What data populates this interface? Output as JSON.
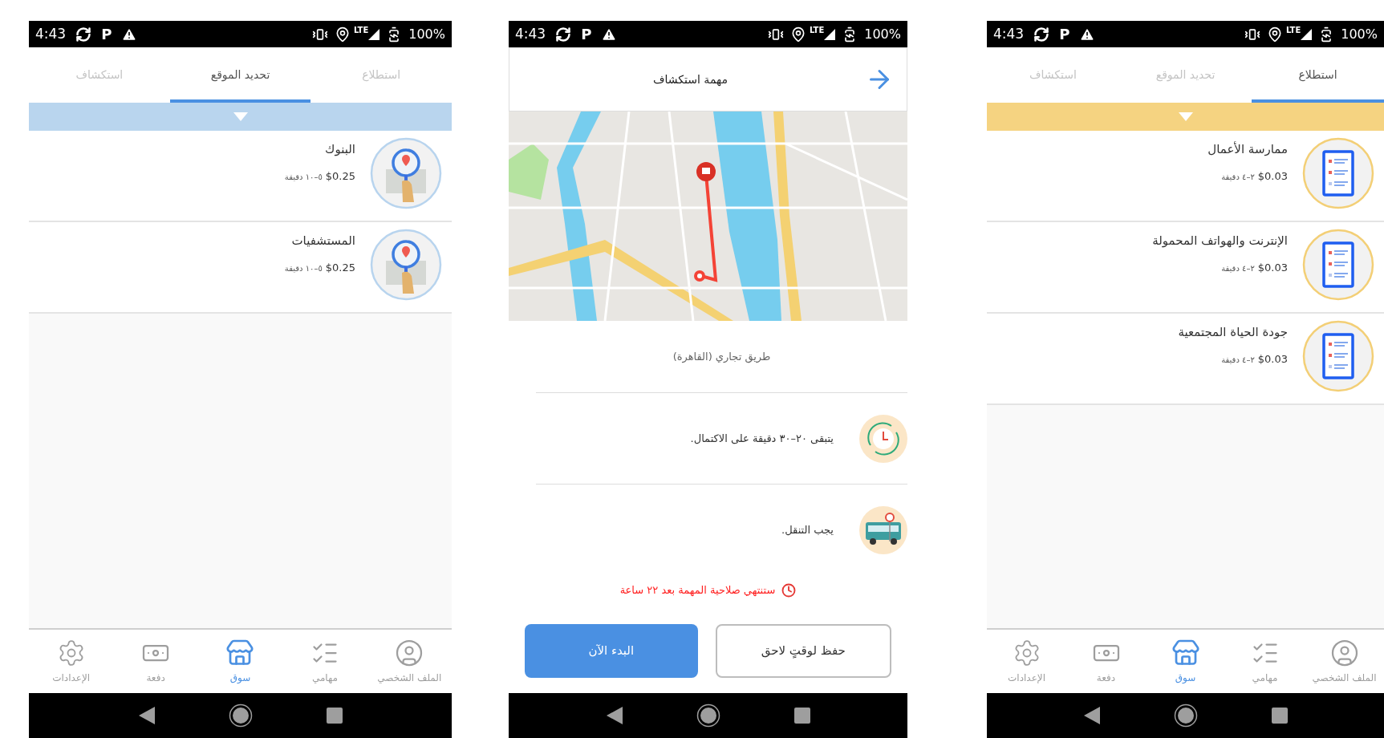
{
  "screens": [
    {
      "kind": "market_list",
      "status_bar": {
        "time": "4:43",
        "letter_icon": "P",
        "network": "LTE",
        "battery": "100%"
      },
      "tabs": [
        {
          "label": "استطلاع",
          "selected": true
        },
        {
          "label": "تحديد الموقع",
          "selected": false
        },
        {
          "label": "استكشاف",
          "selected": false
        }
      ],
      "band": {
        "color": "#f5d381"
      },
      "items": [
        {
          "kind": "survey",
          "title": "ممارسة الأعمال",
          "price": "$0.03",
          "duration": "٢–٤ دقيقة"
        },
        {
          "kind": "survey",
          "title": "الإنترنت والهواتف المحمولة",
          "price": "$0.03",
          "duration": "٢–٤ دقيقة"
        },
        {
          "kind": "survey",
          "title": "جودة الحياة المجتمعية",
          "price": "$0.03",
          "duration": "٢–٤ دقيقة"
        }
      ],
      "bottom_nav": [
        {
          "kind": "profile",
          "label": "الملف الشخصي",
          "selected": false
        },
        {
          "kind": "tasks",
          "label": "مهامي",
          "selected": false
        },
        {
          "kind": "market",
          "label": "سوق",
          "selected": true
        },
        {
          "kind": "payment",
          "label": "دفعة",
          "selected": false
        },
        {
          "kind": "settings",
          "label": "الإعدادات",
          "selected": false
        }
      ]
    },
    {
      "kind": "task_detail",
      "status_bar": {
        "time": "4:43",
        "letter_icon": "P",
        "network": "LTE",
        "battery": "100%"
      },
      "header": {
        "title": "مهمة استكشاف"
      },
      "location": "طريق تجاري (القاهرة)",
      "info": [
        {
          "kind": "time",
          "text": "يتبقى ٢٠–٣٠ دقيقة على الاكتمال."
        },
        {
          "kind": "transit",
          "text": "يجب التنقل."
        }
      ],
      "expiry": "ستنتهي صلاحية المهمة بعد ٢٢ ساعة",
      "buttons": [
        {
          "kind": "secondary",
          "label": "حفظ لوقتٍ لاحق"
        },
        {
          "kind": "primary",
          "label": "البدء الآن"
        }
      ]
    },
    {
      "kind": "market_list",
      "status_bar": {
        "time": "4:43",
        "letter_icon": "P",
        "network": "LTE",
        "battery": "100%"
      },
      "tabs": [
        {
          "label": "استطلاع",
          "selected": false
        },
        {
          "label": "تحديد الموقع",
          "selected": true
        },
        {
          "label": "استكشاف",
          "selected": false
        }
      ],
      "band": {
        "color": "#b9d5ee"
      },
      "items": [
        {
          "kind": "locate",
          "title": "البنوك",
          "price": "$0.25",
          "duration": "٥–١٠ دقيقة"
        },
        {
          "kind": "locate",
          "title": "المستشفيات",
          "price": "$0.25",
          "duration": "٥–١٠ دقيقة"
        }
      ],
      "bottom_nav": [
        {
          "kind": "profile",
          "label": "الملف الشخصي",
          "selected": false
        },
        {
          "kind": "tasks",
          "label": "مهامي",
          "selected": false
        },
        {
          "kind": "market",
          "label": "سوق",
          "selected": true
        },
        {
          "kind": "payment",
          "label": "دفعة",
          "selected": false
        },
        {
          "kind": "settings",
          "label": "الإعدادات",
          "selected": false
        }
      ]
    }
  ]
}
